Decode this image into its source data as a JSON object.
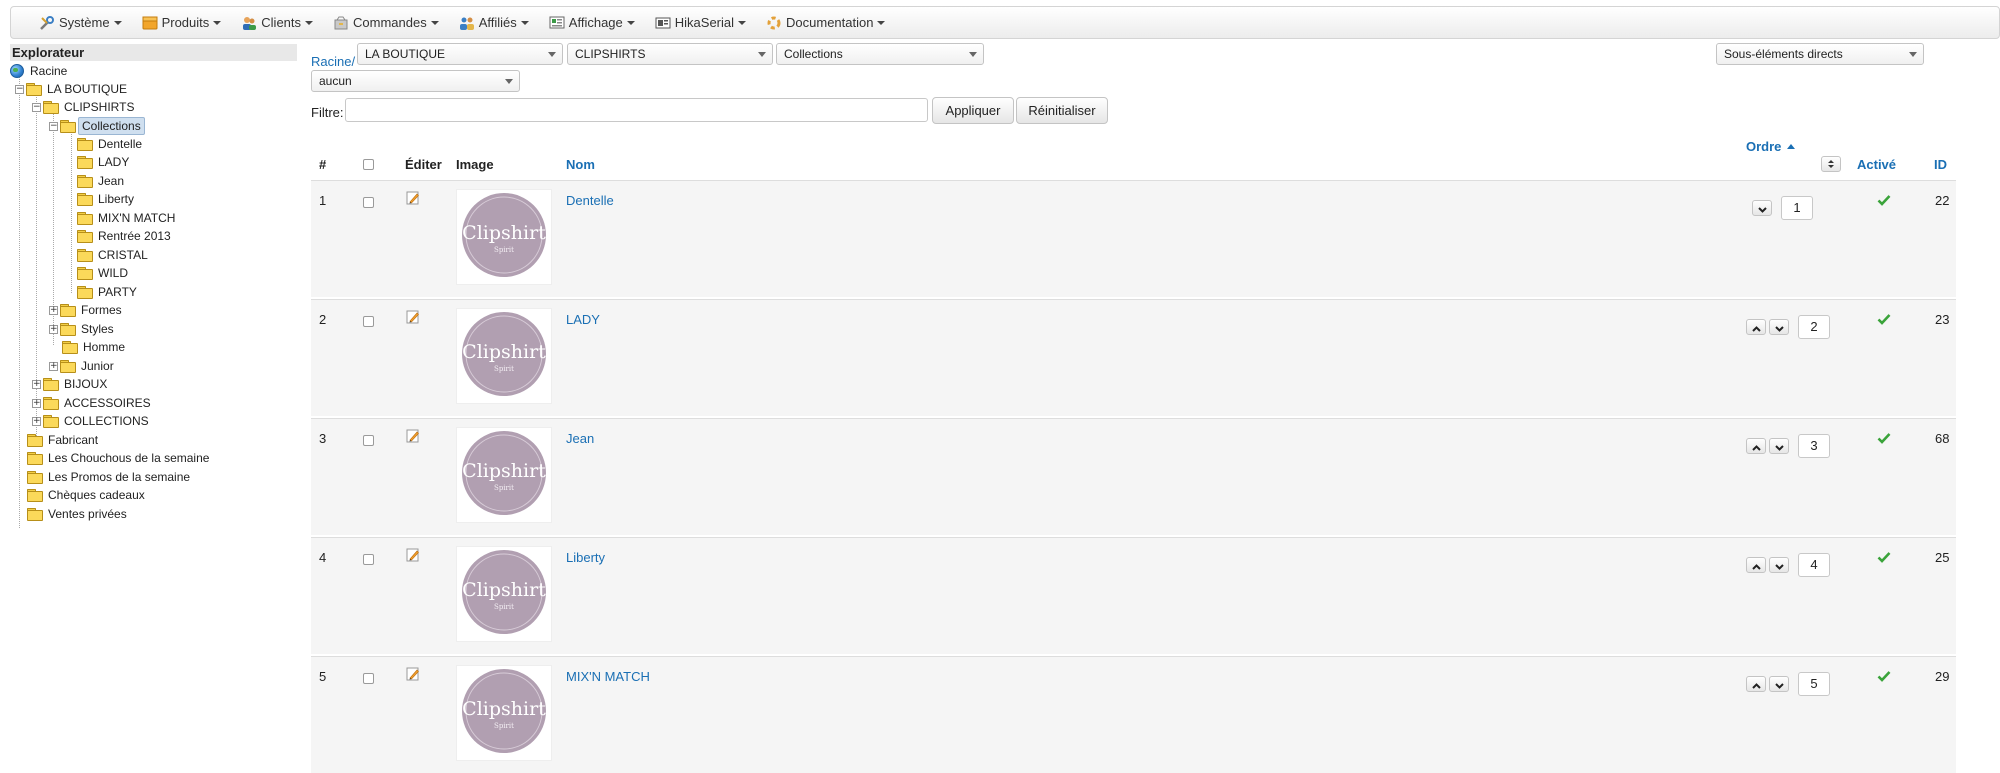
{
  "menu": [
    {
      "label": "Système",
      "icon": "tools-icon"
    },
    {
      "label": "Produits",
      "icon": "box-icon"
    },
    {
      "label": "Clients",
      "icon": "users-icon"
    },
    {
      "label": "Commandes",
      "icon": "order-icon"
    },
    {
      "label": "Affiliés",
      "icon": "affiliates-icon"
    },
    {
      "label": "Affichage",
      "icon": "display-icon"
    },
    {
      "label": "HikaSerial",
      "icon": "serial-icon"
    },
    {
      "label": "Documentation",
      "icon": "documentation-icon"
    }
  ],
  "explorer": {
    "title": "Explorateur",
    "root": "Racine",
    "nodes": {
      "boutique": "LA BOUTIQUE",
      "clipshirts": "CLIPSHIRTS",
      "collections": "Collections",
      "dentelle": "Dentelle",
      "lady": "LADY",
      "jean": "Jean",
      "liberty": "Liberty",
      "mixnmatch": "MIX'N MATCH",
      "rentree": "Rentrée 2013",
      "cristal": "CRISTAL",
      "wild": "WILD",
      "party": "PARTY",
      "formes": "Formes",
      "styles": "Styles",
      "homme": "Homme",
      "junior": "Junior",
      "bijoux": "BIJOUX",
      "accessoires": "ACCESSOIRES",
      "collections_upper": "COLLECTIONS",
      "fabricant": "Fabricant",
      "chouchous": "Les Chouchous de la semaine",
      "promos": "Les Promos de la semaine",
      "cheques": "Chèques cadeaux",
      "ventes": "Ventes privées"
    }
  },
  "breadcrumb": "Racine/",
  "selects": {
    "level1": "LA BOUTIQUE",
    "level2": "CLIPSHIRTS",
    "level3": "Collections",
    "level4": "aucun",
    "scope": "Sous-éléments directs"
  },
  "filter": {
    "label": "Filtre:",
    "value": "",
    "apply": "Appliquer",
    "reset": "Réinitialiser"
  },
  "table": {
    "headers": {
      "num": "#",
      "edit": "Éditer",
      "image": "Image",
      "name": "Nom",
      "order": "Ordre",
      "active": "Activé",
      "id": "ID"
    },
    "image_text": {
      "brand": "Clipshirt",
      "sub": "Spirit"
    },
    "rows": [
      {
        "num": "1",
        "name": "Dentelle",
        "order": "1",
        "id": "22",
        "active": true
      },
      {
        "num": "2",
        "name": "LADY",
        "order": "2",
        "id": "23",
        "active": true
      },
      {
        "num": "3",
        "name": "Jean",
        "order": "3",
        "id": "68",
        "active": true
      },
      {
        "num": "4",
        "name": "Liberty",
        "order": "4",
        "id": "25",
        "active": true
      },
      {
        "num": "5",
        "name": "MIX'N MATCH",
        "order": "5",
        "id": "29",
        "active": true
      }
    ]
  },
  "colors": {
    "link": "#1a6fb4",
    "check": "#3aa33a",
    "row_bg": "#f5f5f5",
    "thumb_circle": "#b19fb1"
  }
}
